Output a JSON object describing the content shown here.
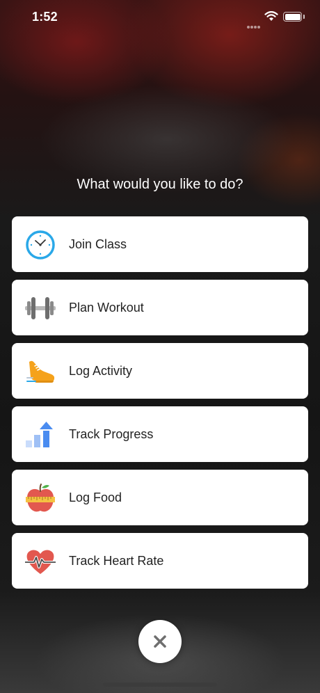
{
  "status_bar": {
    "time": "1:52",
    "icons": [
      "cellular-signal-icon",
      "wifi-icon",
      "battery-icon"
    ]
  },
  "prompt": {
    "title": "What would you like to do?"
  },
  "menu": {
    "items": [
      {
        "label": "Join Class",
        "icon": "clock-icon"
      },
      {
        "label": "Plan Workout",
        "icon": "dumbbell-icon"
      },
      {
        "label": "Log Activity",
        "icon": "sneaker-icon"
      },
      {
        "label": "Track Progress",
        "icon": "progress-chart-icon"
      },
      {
        "label": "Log Food",
        "icon": "apple-icon"
      },
      {
        "label": "Track Heart Rate",
        "icon": "heart-rate-icon"
      }
    ]
  },
  "close": {
    "icon": "close-icon"
  },
  "colors": {
    "card": "#ffffff",
    "label_text": "#222222",
    "clock_blue": "#2aa8e8",
    "progress_blue": "#4a8cf0",
    "sneaker_orange": "#f5a21b",
    "apple_red": "#e2584f",
    "heart_red": "#e2584f",
    "dumbbell_gray": "#7a7a7a"
  }
}
